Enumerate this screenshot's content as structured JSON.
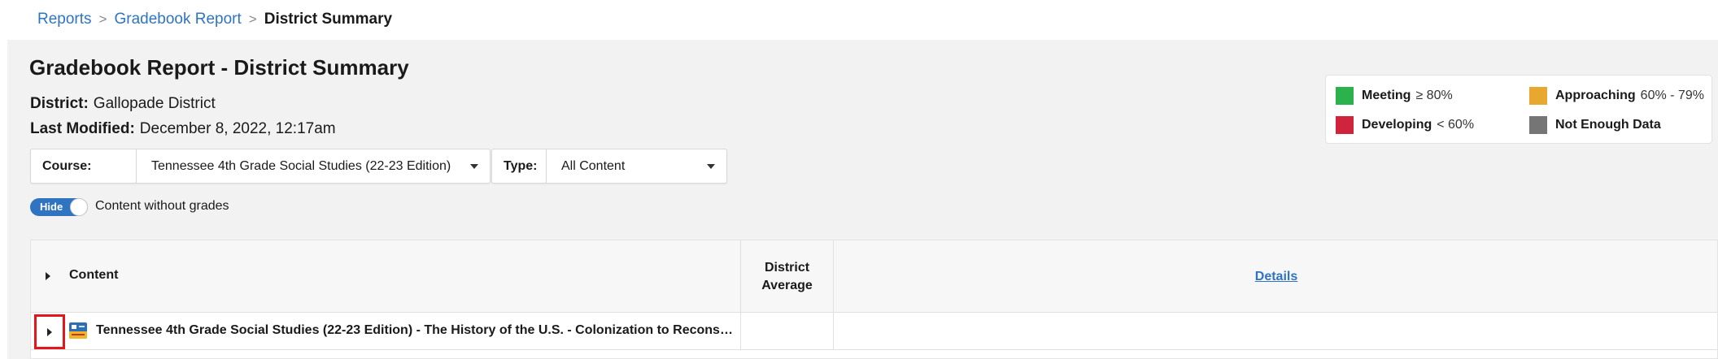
{
  "breadcrumb": {
    "items": [
      "Reports",
      "Gradebook Report"
    ],
    "current": "District Summary",
    "separator": ">"
  },
  "header": {
    "title": "Gradebook Report - District Summary",
    "district_label": "District:",
    "district_value": "Gallopade District",
    "modified_label": "Last Modified:",
    "modified_value": "December 8, 2022, 12:17am"
  },
  "filters": {
    "course_label": "Course:",
    "course_value": "Tennessee 4th Grade Social Studies (22-23 Edition)",
    "type_label": "Type:",
    "type_value": "All Content"
  },
  "toggle": {
    "state_label": "Hide",
    "caption": "Content without grades",
    "on": true
  },
  "legend": {
    "meeting": {
      "name": "Meeting",
      "range": "≥ 80%",
      "color": "#2bb24c"
    },
    "approaching": {
      "name": "Approaching",
      "range": "60% - 79%",
      "color": "#e8a830"
    },
    "developing": {
      "name": "Developing",
      "range": "< 60%",
      "color": "#d0243c"
    },
    "nodata": {
      "name": "Not Enough Data",
      "range": "",
      "color": "#757575"
    }
  },
  "table": {
    "col_content": "Content",
    "col_average": "District Average",
    "col_details": "Details",
    "rows": [
      {
        "title": "Tennessee 4th Grade Social Studies (22-23 Edition) - The History of the U.S. - Colonization to Reconstr...",
        "icon": "book-cover-icon",
        "average": ""
      }
    ]
  },
  "colors": {
    "accent": "#2f74c0",
    "highlight_border": "#e3161b",
    "panel_bg": "#f2f2f2"
  }
}
